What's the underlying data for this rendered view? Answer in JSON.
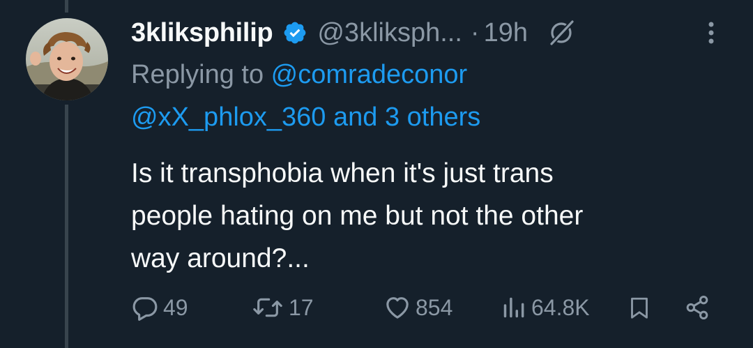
{
  "tweet": {
    "display_name": "3kliksphilip",
    "handle": "@3kliksph...",
    "separator": "·",
    "time": "19h",
    "replying_prefix": "Replying to ",
    "replying_user": "@comradeconor",
    "replying_more": "@xX_phlox_360 and 3 others",
    "text_lines": [
      "Is it transphobia when it's just trans",
      "people hating on me but not the other",
      "way around?..."
    ]
  },
  "actions": {
    "replies": "49",
    "retweets": "17",
    "likes": "854",
    "views": "64.8K"
  },
  "icons": {
    "verified": "verified-badge-icon",
    "grok": "grok-icon",
    "more": "more-vertical-icon",
    "reply": "reply-icon",
    "retweet": "retweet-icon",
    "like": "like-icon",
    "views": "views-icon",
    "bookmark": "bookmark-icon",
    "share": "share-icon"
  },
  "colors": {
    "background": "#15202b",
    "primary_text": "#f7f9f9",
    "secondary_text": "#8b98a5",
    "accent": "#1d9bf0",
    "thread_line": "#38444d"
  }
}
